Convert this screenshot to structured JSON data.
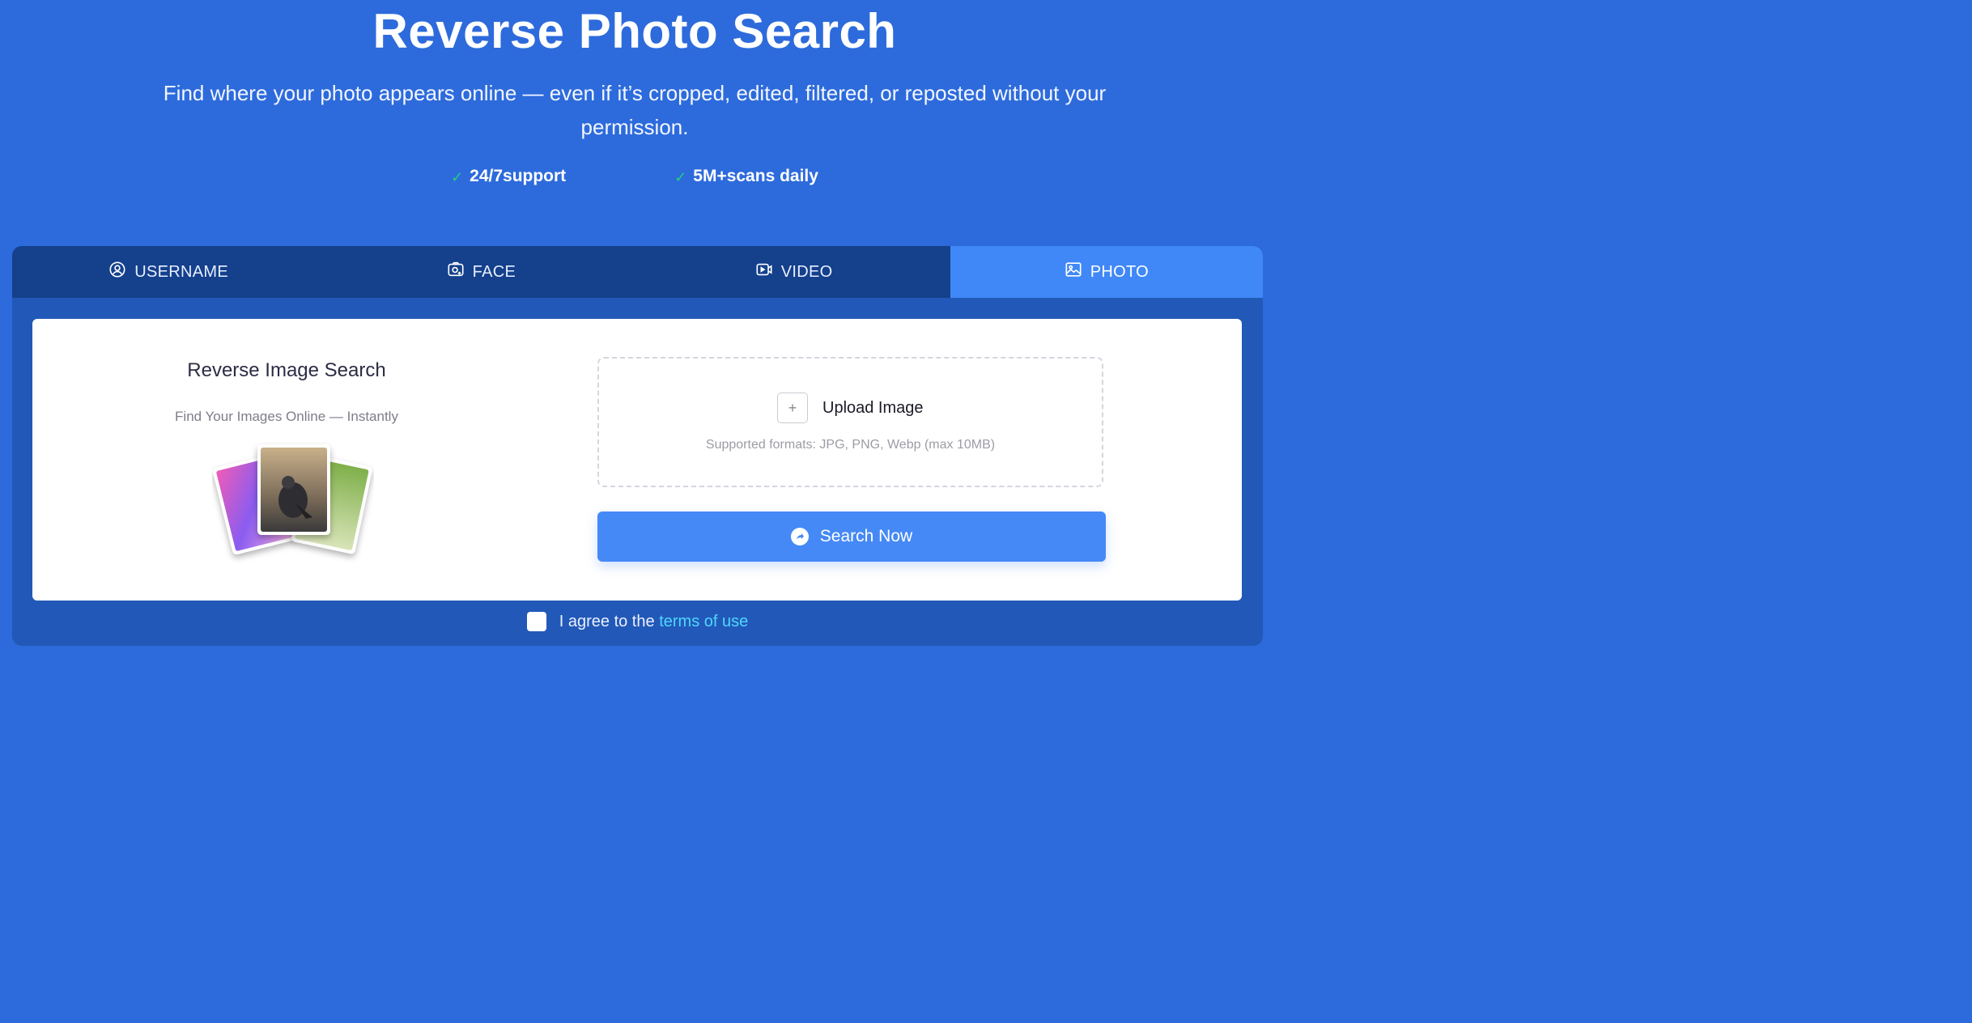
{
  "hero": {
    "title": "Reverse Photo Search",
    "subtitle": "Find where your photo appears online — even if it’s cropped, edited, filtered, or reposted without your permission.",
    "features": [
      {
        "icon": "check-icon",
        "label": "24/7support"
      },
      {
        "icon": "check-icon",
        "label": "5M+scans daily"
      }
    ]
  },
  "tabs": [
    {
      "label": "USERNAME",
      "icon": "user-circle-icon",
      "active": false
    },
    {
      "label": "FACE",
      "icon": "face-scan-icon",
      "active": false
    },
    {
      "label": "VIDEO",
      "icon": "video-icon",
      "active": false
    },
    {
      "label": "PHOTO",
      "icon": "image-icon",
      "active": true
    }
  ],
  "card": {
    "title": "Reverse Image Search",
    "subtitle": "Find Your Images Online — Instantly",
    "illustration_icon": "photo-stack-illustration"
  },
  "upload": {
    "plus": "+",
    "label": "Upload Image",
    "formats": "Supported formats: JPG, PNG, Webp (max 10MB)"
  },
  "search_button": {
    "label": "Search Now",
    "icon": "arrow-circle-icon"
  },
  "agreement": {
    "prefix": "I agree to the",
    "link": "terms of use",
    "checked": false
  },
  "colors": {
    "background": "#2d6bdc",
    "tab_bar": "#14408c",
    "active_tab": "#4088f7",
    "button": "#4589f6",
    "check": "#22d07d",
    "link": "#4fd6ff"
  }
}
